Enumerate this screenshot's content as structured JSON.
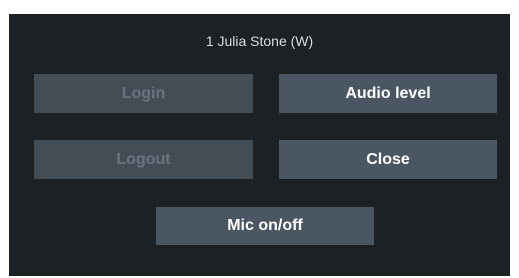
{
  "dialog": {
    "title": "1  Julia Stone (W)",
    "buttons": {
      "login": {
        "label": "Login",
        "enabled": false
      },
      "audio_level": {
        "label": "Audio level",
        "enabled": true
      },
      "logout": {
        "label": "Logout",
        "enabled": false
      },
      "close": {
        "label": "Close",
        "enabled": true
      },
      "mic": {
        "label": "Mic on/off",
        "enabled": true
      }
    }
  },
  "colors": {
    "panel_background": "#1c2125",
    "button_background": "#4a5661",
    "button_disabled_background": "#434d56",
    "button_text": "#ffffff",
    "button_disabled_text": "#687580",
    "title_text": "#d9dcde"
  }
}
